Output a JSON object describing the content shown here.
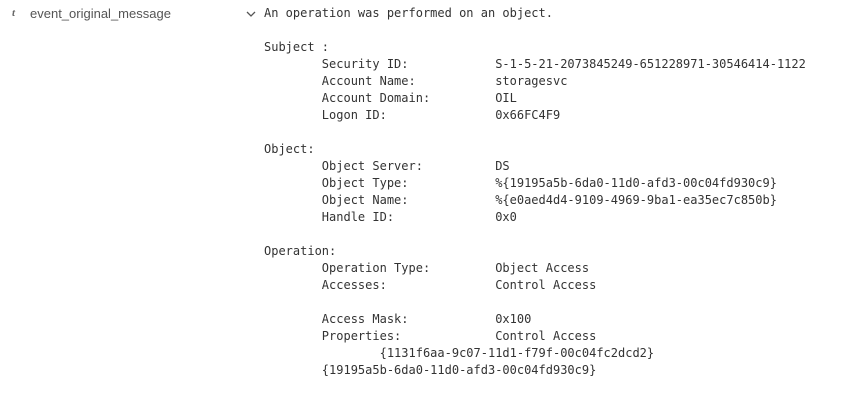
{
  "field": {
    "type_icon": "t",
    "name": "event_original_message",
    "toggle_icon": "chevron-down-icon",
    "value": "An operation was performed on an object.\n\nSubject :\n        Security ID:            S-1-5-21-2073845249-651228971-30546414-1122\n        Account Name:           storagesvc\n        Account Domain:         OIL\n        Logon ID:               0x66FC4F9\n\nObject:\n        Object Server:          DS\n        Object Type:            %{19195a5b-6da0-11d0-afd3-00c04fd930c9}\n        Object Name:            %{e0aed4d4-9109-4969-9ba1-ea35ec7c850b}\n        Handle ID:              0x0\n\nOperation:\n        Operation Type:         Object Access\n        Accesses:               Control Access\n\n        Access Mask:            0x100\n        Properties:             Control Access\n                {1131f6aa-9c07-11d1-f79f-00c04fc2dcd2}\n        {19195a5b-6da0-11d0-afd3-00c04fd930c9}"
  }
}
